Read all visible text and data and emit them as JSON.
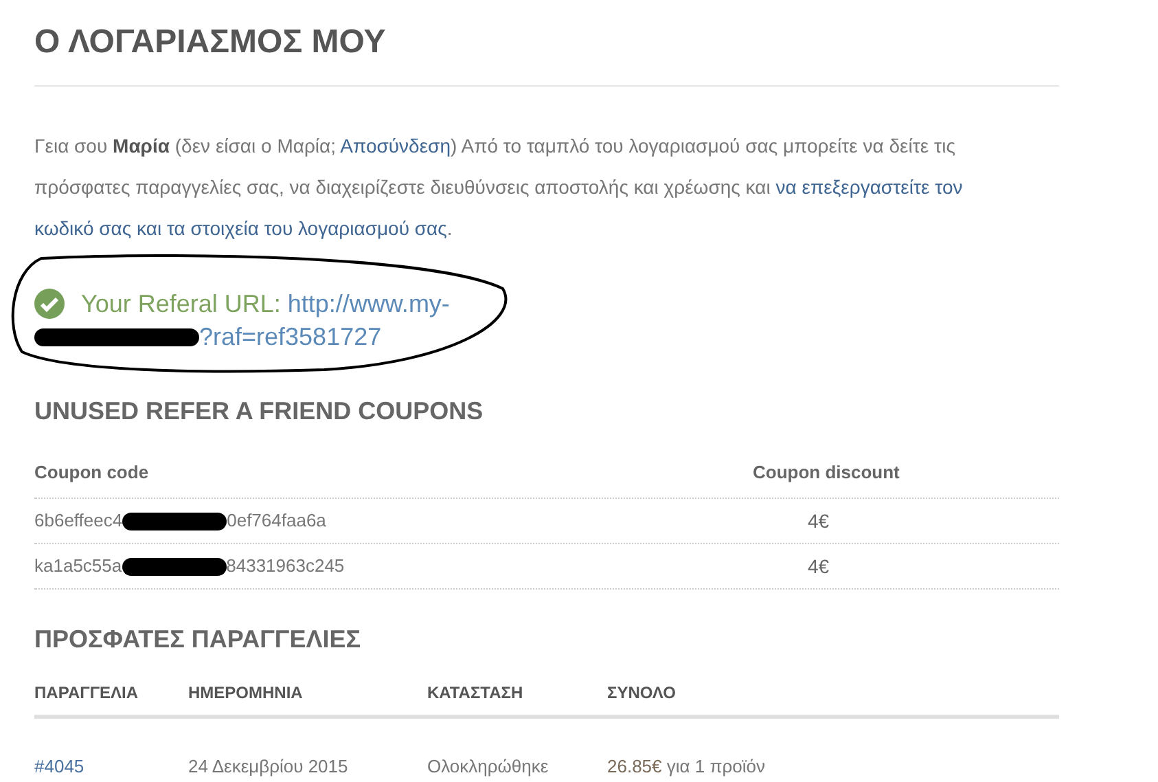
{
  "title": "Ο ΛΟΓΑΡΙΑΣΜΟΣ ΜΟΥ",
  "intro": {
    "greeting": "Γεια σου ",
    "name": "Μαρία",
    "before_link": " (δεν είσαι ο Μαρία; ",
    "logout": "Αποσύνδεση",
    "after_logout": ") Από το ταμπλό του λογαριασμού σας μπορείτε να δείτε τις πρόσφατες παραγγελίες σας, να διαχειρίζεστε διευθύνσεις αποστολής και χρέωσης και ",
    "edit_link_1": "να επεξεργαστείτε τον",
    "edit_link_2": "κωδικό σας και τα στοιχεία του λογαριασμού σας",
    "end": "."
  },
  "referral": {
    "label": "Your Referal URL:",
    "url_start": "http://www.my-",
    "url_end": "?raf=ref3581727"
  },
  "coupons": {
    "heading": "UNUSED REFER A FRIEND COUPONS",
    "columns": [
      "Coupon code",
      "Coupon discount"
    ],
    "rows": [
      {
        "code_start": "6b6effeec4",
        "code_end": "0ef764faa6a",
        "discount": "4€"
      },
      {
        "code_start": "ka1a5c55a",
        "code_end": "84331963c245",
        "discount": "4€"
      }
    ]
  },
  "orders": {
    "heading": "ΠΡΟΣΦΑΤΕΣ ΠΑΡΑΓΓΕΛΙΕΣ",
    "columns": [
      "ΠΑΡΑΓΓΕΛΙΑ",
      "ΗΜΕΡΟΜΗΝΙΑ",
      "ΚΑΤΑΣΤΑΣΗ",
      "ΣΥΝΟΛΟ"
    ],
    "rows": [
      {
        "number": "#4045",
        "date": "24 Δεκεμβρίου 2015",
        "status": "Ολοκληρώθηκε",
        "total": "26.85€",
        "total_note": " για 1 προϊόν"
      }
    ]
  }
}
